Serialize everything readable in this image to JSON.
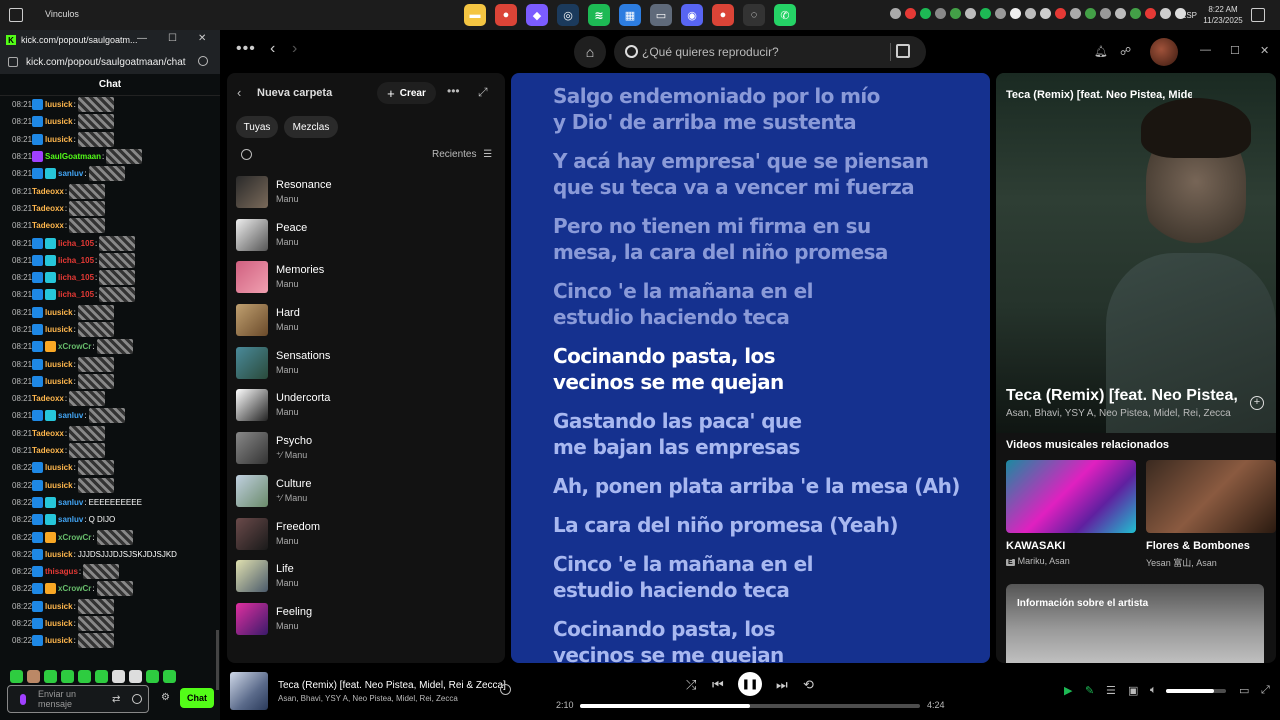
{
  "taskbar": {
    "window_title": "Vinculos",
    "apps": [
      {
        "icon": "file-explorer-icon",
        "color": "#f4c542",
        "glyph": "▬"
      },
      {
        "icon": "chrome-icon",
        "color": "#db4437",
        "glyph": "●"
      },
      {
        "icon": "copilot-icon",
        "color": "#7b5cff",
        "glyph": "◆"
      },
      {
        "icon": "steam-icon",
        "color": "#1b3a5c",
        "glyph": "◎"
      },
      {
        "icon": "spotify-icon",
        "color": "#1db954",
        "glyph": "≋"
      },
      {
        "icon": "store-icon",
        "color": "#2d7de0",
        "glyph": "▦"
      },
      {
        "icon": "folder-icon",
        "color": "#5f6a7a",
        "glyph": "▭"
      },
      {
        "icon": "discord-icon",
        "color": "#5865f2",
        "glyph": "◉"
      },
      {
        "icon": "chrome-icon-2",
        "color": "#db4437",
        "glyph": "●"
      },
      {
        "icon": "obs-icon",
        "color": "#333333",
        "glyph": "◌"
      },
      {
        "icon": "whatsapp-icon",
        "color": "#25d366",
        "glyph": "✆"
      }
    ],
    "tray_colors": [
      "#aaaaaa",
      "#e53935",
      "#1db954",
      "#888888",
      "#43a047",
      "#bbbbbb",
      "#1db954",
      "#999999",
      "#eeeeee",
      "#bbbbbb",
      "#cccccc",
      "#e53935",
      "#aaaaaa",
      "#43a047",
      "#999999",
      "#bbbbbb",
      "#43a047",
      "#e53935",
      "#cccccc",
      "#dddddd"
    ],
    "language": "ESP",
    "time": "8:22 AM",
    "date": "11/23/2025"
  },
  "kick": {
    "tab_title": "kick.com/popout/saulgoatm...",
    "url": "kick.com/popout/saulgoatmaan/chat",
    "chat_heading": "Chat",
    "messages": [
      {
        "time": "08:21",
        "user": "luusick",
        "color": "#ffb74d",
        "badges": [
          "#1e88e5"
        ],
        "emote": true,
        "text": ""
      },
      {
        "time": "08:21",
        "user": "luusick",
        "color": "#ffb74d",
        "badges": [
          "#1e88e5"
        ],
        "emote": true,
        "text": ""
      },
      {
        "time": "08:21",
        "user": "luusick",
        "color": "#ffb74d",
        "badges": [
          "#1e88e5"
        ],
        "emote": true,
        "text": ""
      },
      {
        "time": "08:21",
        "user": "SaulGoatmaan",
        "color": "#53fc18",
        "badges": [
          "#a040ff"
        ],
        "emote": true,
        "text": ""
      },
      {
        "time": "08:21",
        "user": "sanluv",
        "color": "#42a5f5",
        "badges": [
          "#1e88e5",
          "#26c6da"
        ],
        "emote": true,
        "text": ""
      },
      {
        "time": "08:21",
        "user": "Tadeoxx",
        "color": "#ffb74d",
        "badges": [],
        "emote": true,
        "text": ""
      },
      {
        "time": "08:21",
        "user": "Tadeoxx",
        "color": "#ffb74d",
        "badges": [],
        "emote": true,
        "text": ""
      },
      {
        "time": "08:21",
        "user": "Tadeoxx",
        "color": "#ffb74d",
        "badges": [],
        "emote": true,
        "text": ""
      },
      {
        "time": "08:21",
        "user": "licha_105",
        "color": "#e53935",
        "badges": [
          "#1e88e5",
          "#26c6da"
        ],
        "emote": true,
        "text": ""
      },
      {
        "time": "08:21",
        "user": "licha_105",
        "color": "#e53935",
        "badges": [
          "#1e88e5",
          "#26c6da"
        ],
        "emote": true,
        "text": ""
      },
      {
        "time": "08:21",
        "user": "licha_105",
        "color": "#e53935",
        "badges": [
          "#1e88e5",
          "#26c6da"
        ],
        "emote": true,
        "text": ""
      },
      {
        "time": "08:21",
        "user": "licha_105",
        "color": "#e53935",
        "badges": [
          "#1e88e5",
          "#26c6da"
        ],
        "emote": true,
        "text": ""
      },
      {
        "time": "08:21",
        "user": "luusick",
        "color": "#ffb74d",
        "badges": [
          "#1e88e5"
        ],
        "emote": true,
        "text": ""
      },
      {
        "time": "08:21",
        "user": "luusick",
        "color": "#ffb74d",
        "badges": [
          "#1e88e5"
        ],
        "emote": true,
        "text": ""
      },
      {
        "time": "08:21",
        "user": "xCrowCr",
        "color": "#66bb6a",
        "badges": [
          "#1e88e5",
          "#f9a825"
        ],
        "emote": true,
        "text": ""
      },
      {
        "time": "08:21",
        "user": "luusick",
        "color": "#ffb74d",
        "badges": [
          "#1e88e5"
        ],
        "emote": true,
        "text": ""
      },
      {
        "time": "08:21",
        "user": "luusick",
        "color": "#ffb74d",
        "badges": [
          "#1e88e5"
        ],
        "emote": true,
        "text": ""
      },
      {
        "time": "08:21",
        "user": "Tadeoxx",
        "color": "#ffb74d",
        "badges": [],
        "emote": true,
        "text": ""
      },
      {
        "time": "08:21",
        "user": "sanluv",
        "color": "#42a5f5",
        "badges": [
          "#1e88e5",
          "#26c6da"
        ],
        "emote": true,
        "text": ""
      },
      {
        "time": "08:21",
        "user": "Tadeoxx",
        "color": "#ffb74d",
        "badges": [],
        "emote": true,
        "text": ""
      },
      {
        "time": "08:21",
        "user": "Tadeoxx",
        "color": "#ffb74d",
        "badges": [],
        "emote": true,
        "text": ""
      },
      {
        "time": "08:22",
        "user": "luusick",
        "color": "#ffb74d",
        "badges": [
          "#1e88e5"
        ],
        "emote": true,
        "text": ""
      },
      {
        "time": "08:22",
        "user": "luusick",
        "color": "#ffb74d",
        "badges": [
          "#1e88e5"
        ],
        "emote": true,
        "text": ""
      },
      {
        "time": "08:22",
        "user": "sanluv",
        "color": "#42a5f5",
        "badges": [
          "#1e88e5",
          "#26c6da"
        ],
        "emote": false,
        "text": "EEEEEEEEEE"
      },
      {
        "time": "08:22",
        "user": "sanluv",
        "color": "#42a5f5",
        "badges": [
          "#1e88e5",
          "#26c6da"
        ],
        "emote": false,
        "text": "Q DIJO"
      },
      {
        "time": "08:22",
        "user": "xCrowCr",
        "color": "#66bb6a",
        "badges": [
          "#1e88e5",
          "#f9a825"
        ],
        "emote": true,
        "text": ""
      },
      {
        "time": "08:22",
        "user": "luusick",
        "color": "#ffb74d",
        "badges": [
          "#1e88e5"
        ],
        "emote": false,
        "text": "JJJDSJJJDJSJSKJDJSJKD"
      },
      {
        "time": "08:22",
        "user": "thisagus",
        "color": "#e53935",
        "badges": [
          "#1e88e5"
        ],
        "emote": true,
        "text": ""
      },
      {
        "time": "08:22",
        "user": "xCrowCr",
        "color": "#66bb6a",
        "badges": [
          "#1e88e5",
          "#f9a825"
        ],
        "emote": true,
        "text": ""
      },
      {
        "time": "08:22",
        "user": "luusick",
        "color": "#ffb74d",
        "badges": [
          "#1e88e5"
        ],
        "emote": true,
        "text": ""
      },
      {
        "time": "08:22",
        "user": "luusick",
        "color": "#ffb74d",
        "badges": [
          "#1e88e5"
        ],
        "emote": true,
        "text": ""
      },
      {
        "time": "08:22",
        "user": "luusick",
        "color": "#ffb74d",
        "badges": [
          "#1e88e5"
        ],
        "emote": true,
        "text": ""
      }
    ],
    "input_placeholder": "Enviar un mensaje",
    "send_label": "Chat"
  },
  "spotify": {
    "search_placeholder": "¿Qué quieres reproducir?",
    "library": {
      "folder_title": "Nueva carpeta",
      "create_label": "Crear",
      "chips": [
        "Tuyas",
        "Mezclas"
      ],
      "sort_label": "Recientes",
      "items": [
        {
          "name": "Resonance",
          "owner": "Manu",
          "collab": false,
          "cover": "linear-gradient(135deg,#2a2a2a,#7a6a5a)"
        },
        {
          "name": "Peace",
          "owner": "Manu",
          "collab": false,
          "cover": "linear-gradient(135deg,#eeeeee,#555555)"
        },
        {
          "name": "Memories",
          "owner": "Manu",
          "collab": false,
          "cover": "linear-gradient(135deg,#d06080,#f0a0b0)"
        },
        {
          "name": "Hard",
          "owner": "Manu",
          "collab": false,
          "cover": "linear-gradient(135deg,#c0a070,#6a4a2a)"
        },
        {
          "name": "Sensations",
          "owner": "Manu",
          "collab": false,
          "cover": "linear-gradient(135deg,#4a8a9a,#2a4a3a)"
        },
        {
          "name": "Undercorta",
          "owner": "Manu",
          "collab": false,
          "cover": "linear-gradient(135deg,#ffffff,#222222)"
        },
        {
          "name": "Psycho",
          "owner": "Manu",
          "collab": true,
          "cover": "linear-gradient(135deg,#888888,#333333)"
        },
        {
          "name": "Culture",
          "owner": "Manu",
          "collab": true,
          "cover": "linear-gradient(135deg,#c0d0e0,#6a8a6a)"
        },
        {
          "name": "Freedom",
          "owner": "Manu",
          "collab": false,
          "cover": "linear-gradient(135deg,#6a4a4a,#1a1a1a)"
        },
        {
          "name": "Life",
          "owner": "Manu",
          "collab": false,
          "cover": "linear-gradient(135deg,#e0e0b0,#4a5a6a)"
        },
        {
          "name": "Feeling",
          "owner": "Manu",
          "collab": false,
          "cover": "linear-gradient(135deg,#e030a0,#3a1a6a)"
        }
      ]
    },
    "lyrics": [
      {
        "line1": "Salgo endemoniado por lo mío",
        "line2": "y Dio' de arriba me sustenta",
        "state": "past"
      },
      {
        "line1": "Y acá hay empresa' que se piensan",
        "line2": "que su teca va a vencer mi fuerza",
        "state": "past"
      },
      {
        "line1": "Pero no tienen mi firma en su",
        "line2": "mesa, la cara del niño promesa",
        "state": "past"
      },
      {
        "line1": "Cinco 'e la mañana en el",
        "line2": "estudio haciendo teca",
        "state": "past"
      },
      {
        "line1": "Cocinando pasta, los",
        "line2": "vecinos se me quejan",
        "state": "cur"
      },
      {
        "line1": "Gastando las paca' que",
        "line2": "me bajan las empresas",
        "state": "next"
      },
      {
        "line1": "Ah, ponen plata arriba 'e la mesa (Ah)",
        "line2": "",
        "state": "next"
      },
      {
        "line1": "La cara del niño promesa (Yeah)",
        "line2": "",
        "state": "next"
      },
      {
        "line1": "Cinco 'e la mañana en el",
        "line2": "estudio haciendo teca",
        "state": "next"
      },
      {
        "line1": "Cocinando pasta, los",
        "line2": "vecinos se me quejan",
        "state": "next"
      }
    ],
    "now_playing": {
      "header_title": "Teca (Remix) [feat. Neo Pistea, Midel, Rei & Zecca]",
      "title": "Teca (Remix) [feat. Neo Pistea, Midel, Rei & Zecca]",
      "artists": "Asan, Bhavi, YSY A, Neo Pistea, Midel, Rei, Zecca",
      "related_heading": "Videos musicales relacionados",
      "videos": [
        {
          "title": "KAWASAKI",
          "artists": "Mariku, Asan",
          "explicit": true,
          "thumb": "linear-gradient(135deg,#1a8aa0,#e020c0 45%,#6020a0 70%,#20c0d0)"
        },
        {
          "title": "Flores & Bombones",
          "artists": "Yesan 富山, Asan",
          "explicit": false,
          "thumb": "linear-gradient(135deg,#3a2a20,#8a5a40 50%,#2a1a10)"
        }
      ],
      "artist_info_label": "Información sobre el artista"
    },
    "player": {
      "title": "Teca (Remix) [feat. Neo Pistea, Midel, Rei & Zecca]",
      "artists": "Asan, Bhavi, YSY A, Neo Pistea, Midel, Rei, Zecca",
      "current_time": "2:10",
      "total_time": "4:24",
      "progress": 0.5,
      "volume": 0.8
    }
  }
}
